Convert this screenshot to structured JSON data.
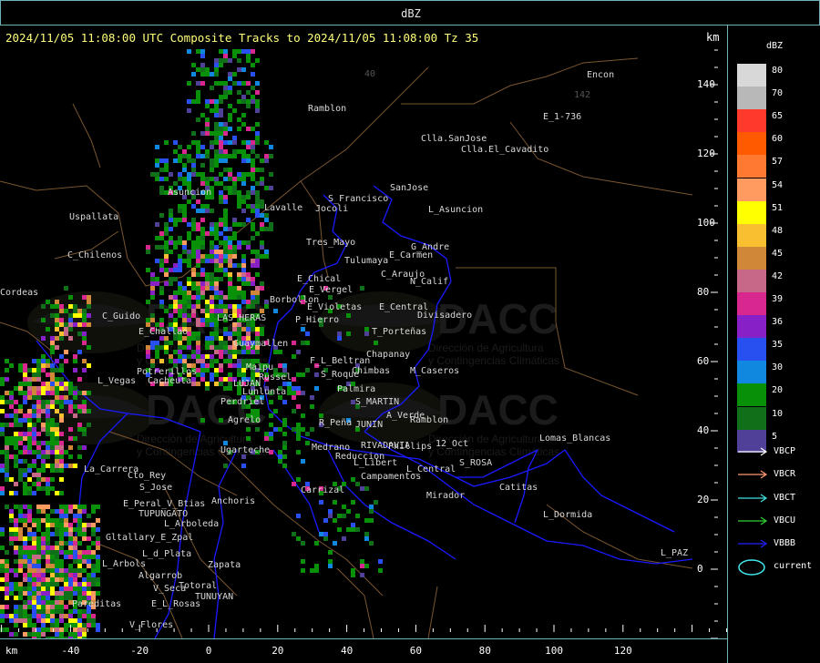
{
  "header": {
    "top_title": "dBZ",
    "title": "2024/11/05 11:08:00 UTC Composite Tracks to 2024/11/05 11:08:00 Tz 35",
    "km_label": "km"
  },
  "x_axis": {
    "unit": "km",
    "ticks": [
      "-40",
      "-20",
      "0",
      "20",
      "40",
      "60",
      "80",
      "100",
      "120"
    ]
  },
  "y_axis": {
    "ticks": [
      "140",
      "120",
      "100",
      "80",
      "60",
      "40",
      "20",
      "0"
    ]
  },
  "legend": {
    "title": "dBZ",
    "levels": [
      {
        "label": "80",
        "color": "#d8d8d8"
      },
      {
        "label": "70",
        "color": "#b8b8b8"
      },
      {
        "label": "65",
        "color": "#ff3a2a"
      },
      {
        "label": "60",
        "color": "#ff5a00"
      },
      {
        "label": "57",
        "color": "#ff7a30"
      },
      {
        "label": "54",
        "color": "#ff9a60"
      },
      {
        "label": "51",
        "color": "#ffff00"
      },
      {
        "label": "48",
        "color": "#f8c030"
      },
      {
        "label": "45",
        "color": "#d08838"
      },
      {
        "label": "42",
        "color": "#c86888"
      },
      {
        "label": "39",
        "color": "#d82890"
      },
      {
        "label": "36",
        "color": "#8820c8"
      },
      {
        "label": "35",
        "color": "#2850f0"
      },
      {
        "label": "30",
        "color": "#1088e0"
      },
      {
        "label": "20",
        "color": "#089008"
      },
      {
        "label": "10",
        "color": "#10701a"
      },
      {
        "label": "5",
        "color": "#504098"
      }
    ],
    "tracks": [
      {
        "label": "VBCP",
        "color": "#ffffff"
      },
      {
        "label": "VBCR",
        "color": "#ff9a70"
      },
      {
        "label": "VBCT",
        "color": "#40e0e0"
      },
      {
        "label": "VBCU",
        "color": "#30d030"
      },
      {
        "label": "VBBB",
        "color": "#2020ff"
      }
    ],
    "current_label": "current"
  },
  "watermark": {
    "brand": "DACC",
    "subtitle_1": "Dirección de Agricultura",
    "subtitle_2": "y Contingencias Climáticas"
  },
  "places": [
    {
      "name": "Ramblon"
    },
    {
      "name": "Encon"
    },
    {
      "name": "E_1-736"
    },
    {
      "name": "Clla.SanJose"
    },
    {
      "name": "Clla.El_Cavadito"
    },
    {
      "name": "Asuncion"
    },
    {
      "name": "Lavalle"
    },
    {
      "name": "Uspallata"
    },
    {
      "name": "S_Francisco"
    },
    {
      "name": "Jocoli"
    },
    {
      "name": "SanJose"
    },
    {
      "name": "L_Asuncion"
    },
    {
      "name": "Tres_Mayo"
    },
    {
      "name": "G_Andre"
    },
    {
      "name": "Tulumaya"
    },
    {
      "name": "E_Carmen"
    },
    {
      "name": "C_Chilenos"
    },
    {
      "name": "E_Chical"
    },
    {
      "name": "C_Araujo"
    },
    {
      "name": "E_Vergel"
    },
    {
      "name": "N_Calif"
    },
    {
      "name": "Borbollon"
    },
    {
      "name": "LAS_HERAS"
    },
    {
      "name": "C_Guido"
    },
    {
      "name": "E_Violetas"
    },
    {
      "name": "E_Central"
    },
    {
      "name": "P_Hierro"
    },
    {
      "name": "Divisadero"
    },
    {
      "name": "E_Challao"
    },
    {
      "name": "T_Porteñas"
    },
    {
      "name": "Guaymallen"
    },
    {
      "name": "Chapanay"
    },
    {
      "name": "F_L_Beltran"
    },
    {
      "name": "Maipu"
    },
    {
      "name": "Chimbas"
    },
    {
      "name": "M_Caseros"
    },
    {
      "name": "Potrerillos"
    },
    {
      "name": "Russel"
    },
    {
      "name": "S_Roque"
    },
    {
      "name": "L_Vegas"
    },
    {
      "name": "Cacheuta"
    },
    {
      "name": "LUJAN"
    },
    {
      "name": "Palmira"
    },
    {
      "name": "Lunlunta"
    },
    {
      "name": "S_MARTIN"
    },
    {
      "name": "Perdriel"
    },
    {
      "name": "A_Verde"
    },
    {
      "name": "R_Peña"
    },
    {
      "name": "JUNIN"
    },
    {
      "name": "Ramblon"
    },
    {
      "name": "Agrelo"
    },
    {
      "name": "Lomas_Blancas"
    },
    {
      "name": "RIVADAVIA"
    },
    {
      "name": "Phillips"
    },
    {
      "name": "12_Oct"
    },
    {
      "name": "Ugarteche"
    },
    {
      "name": "Medrano"
    },
    {
      "name": "Reduccion"
    },
    {
      "name": "L_Libert"
    },
    {
      "name": "S_ROSA"
    },
    {
      "name": "La_Carrera"
    },
    {
      "name": "L_Central"
    },
    {
      "name": "Cto_Rey"
    },
    {
      "name": "Campamentos"
    },
    {
      "name": "S_Jose"
    },
    {
      "name": "Carrizal"
    },
    {
      "name": "Catitas"
    },
    {
      "name": "Anchoris"
    },
    {
      "name": "Mirador"
    },
    {
      "name": "E_Peral_V_Btias"
    },
    {
      "name": "TUPUNGATO"
    },
    {
      "name": "L_Dormida"
    },
    {
      "name": "L_Arboleda"
    },
    {
      "name": "Gltallary_E_Zpal"
    },
    {
      "name": "L_PAZ"
    },
    {
      "name": "L_d_Plata"
    },
    {
      "name": "L_Arbols"
    },
    {
      "name": "Zapata"
    },
    {
      "name": "Algarrob"
    },
    {
      "name": "V_Seca"
    },
    {
      "name": "Totoral"
    },
    {
      "name": "TUNUYAN"
    },
    {
      "name": "E_L_Rosas"
    },
    {
      "name": "Pareditas"
    },
    {
      "name": "V_Flores"
    },
    {
      "name": "Cordeas"
    },
    {
      "name": "Ruta_142"
    },
    {
      "name": "Ruta_40"
    }
  ]
}
